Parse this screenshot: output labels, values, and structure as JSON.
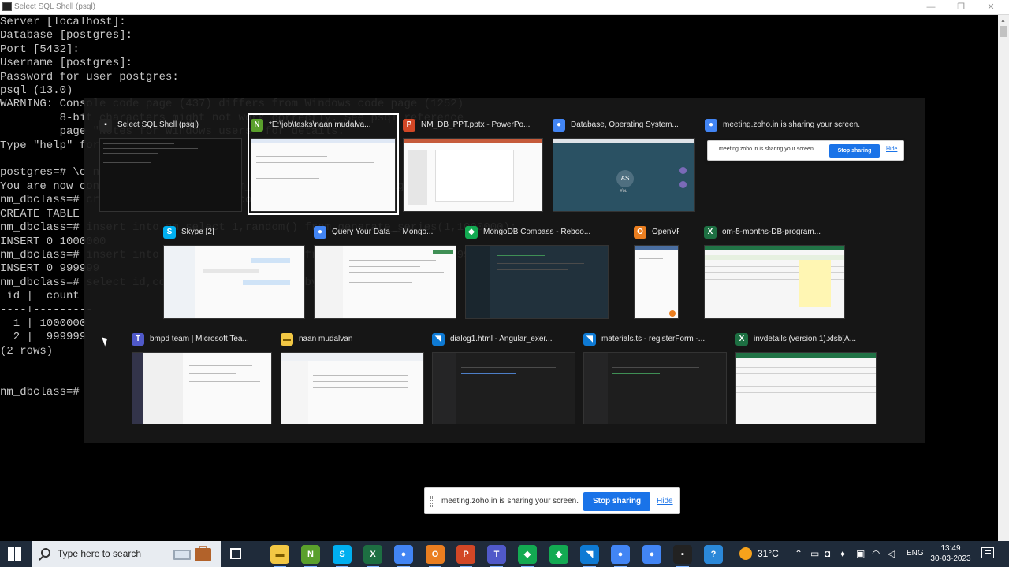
{
  "window": {
    "title": "Select SQL Shell (psql)",
    "minimize": "—",
    "restore": "❐",
    "close": "✕"
  },
  "console": {
    "lines": [
      "Server [localhost]:",
      "Database [postgres]:",
      "Port [5432]:",
      "Username [postgres]:",
      "Password for user postgres:",
      "psql (13.0)",
      "WARNING: Console code page (437) differs from Windows code page (1252)",
      "         8-bit characters might not work correctly. See psql reference",
      "         page \"Notes for Windows users\" for details.",
      "Type \"help\" for help.",
      "",
      "postgres=# \\c nm_dbclass",
      "You are now connected to database \"nm_dbclass\" as user \"postgres\".",
      "nm_dbclass=# create table nm(id int,count int);",
      "CREATE TABLE",
      "nm_dbclass=# insert into nm select 1,random() from generate_series(1,1000000);",
      "INSERT 0 1000000",
      "nm_dbclass=# insert into nm select 2,random() from generate_series(1,999999);",
      "INSERT 0 999999",
      "nm_dbclass=# select id,count(*) from nm group by id;",
      " id |  count",
      "----+---------",
      "  1 | 1000000",
      "  2 |  999999",
      "(2 rows)",
      "",
      "",
      "nm_dbclass=#"
    ]
  },
  "switcher": {
    "windows": [
      {
        "title": "Select SQL Shell (psql)",
        "icon": "console-icon",
        "glyph": "▪",
        "color": "#222222",
        "selected": false
      },
      {
        "title": "*E:\\job\\tasks\\naan mudalva...",
        "icon": "notepadpp-icon",
        "glyph": "N",
        "color": "#5aa02c",
        "selected": true
      },
      {
        "title": "NM_DB_PPT.pptx - PowerPo...",
        "icon": "powerpoint-icon",
        "glyph": "P",
        "color": "#d24726",
        "selected": false
      },
      {
        "title": "Database, Operating System...",
        "icon": "chrome-icon",
        "glyph": "●",
        "color": "#4285f4",
        "selected": false
      },
      {
        "title": "meeting.zoho.in is sharing your screen.",
        "icon": "chrome-icon",
        "glyph": "●",
        "color": "#4285f4",
        "selected": false
      },
      {
        "title": "Skype [2]",
        "icon": "skype-icon",
        "glyph": "S",
        "color": "#00aff0",
        "selected": false
      },
      {
        "title": "Query Your Data — Mongo...",
        "icon": "chrome-icon",
        "glyph": "●",
        "color": "#4285f4",
        "selected": false
      },
      {
        "title": "MongoDB Compass - Reboo...",
        "icon": "mongodb-compass-icon",
        "glyph": "◆",
        "color": "#13aa52",
        "selected": false
      },
      {
        "title": "OpenVPN...",
        "icon": "openvpn-icon",
        "glyph": "O",
        "color": "#ea7e20",
        "selected": false
      },
      {
        "title": "om-5-months-DB-program...",
        "icon": "excel-icon",
        "glyph": "X",
        "color": "#1d6f42",
        "selected": false
      },
      {
        "title": "bmpd team | Microsoft Tea...",
        "icon": "teams-icon",
        "glyph": "T",
        "color": "#5059c9",
        "selected": false
      },
      {
        "title": "naan mudalvan",
        "icon": "folder-icon",
        "glyph": "▬",
        "color": "#f2c744",
        "selected": false
      },
      {
        "title": "dialog1.html - Angular_exer...",
        "icon": "vscode-icon",
        "glyph": "◥",
        "color": "#0e7ad4",
        "selected": false
      },
      {
        "title": "materials.ts - registerForm -...",
        "icon": "vscode-icon",
        "glyph": "◥",
        "color": "#0e7ad4",
        "selected": false
      },
      {
        "title": "invdetails (version 1).xlsb[A...",
        "icon": "excel-icon",
        "glyph": "X",
        "color": "#1d6f42",
        "selected": false
      }
    ],
    "meet_avatar": "AS",
    "meet_name": "You"
  },
  "share_bar": {
    "message": "meeting.zoho.in is sharing your screen.",
    "stop_label": "Stop sharing",
    "hide_label": "Hide"
  },
  "taskbar": {
    "search_placeholder": "Type here to search",
    "pinned": [
      {
        "name": "file-explorer-icon",
        "glyph": "▬",
        "color": "#f2c744"
      },
      {
        "name": "notepadpp-icon",
        "glyph": "N",
        "color": "#5aa02c"
      },
      {
        "name": "skype-icon",
        "glyph": "S",
        "color": "#00aff0"
      },
      {
        "name": "excel-icon",
        "glyph": "X",
        "color": "#1d6f42"
      },
      {
        "name": "chrome-icon",
        "glyph": "●",
        "color": "#4285f4"
      },
      {
        "name": "openvpn-icon",
        "glyph": "O",
        "color": "#ea7e20"
      },
      {
        "name": "powerpoint-icon",
        "glyph": "P",
        "color": "#d24726"
      },
      {
        "name": "teams-icon",
        "glyph": "T",
        "color": "#5059c9"
      },
      {
        "name": "mongodb-compass-icon",
        "glyph": "◆",
        "color": "#13aa52"
      },
      {
        "name": "mongodb-icon",
        "glyph": "◆",
        "color": "#13aa52"
      },
      {
        "name": "vscode-icon",
        "glyph": "◥",
        "color": "#0e7ad4"
      },
      {
        "name": "chrome-icon",
        "glyph": "●",
        "color": "#4285f4"
      },
      {
        "name": "chrome-icon",
        "glyph": "●",
        "color": "#4285f4"
      },
      {
        "name": "console-icon",
        "glyph": "▪",
        "color": "#222222"
      },
      {
        "name": "help-icon",
        "glyph": "?",
        "color": "#2b88d8"
      }
    ],
    "temperature": "31°C",
    "language": "ENG",
    "time": "13:49",
    "date": "30-03-2023"
  }
}
